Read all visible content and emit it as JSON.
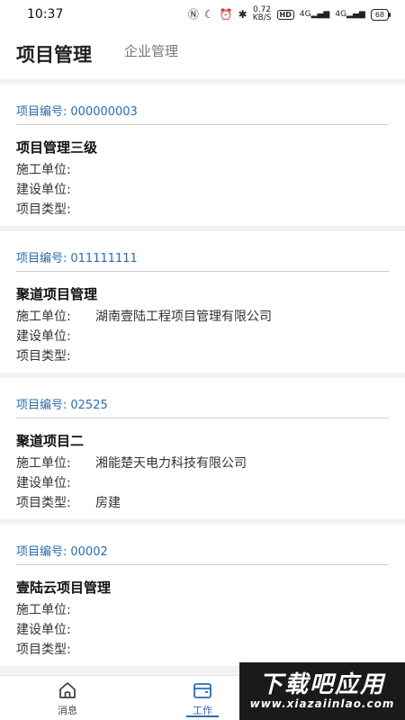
{
  "status": {
    "time": "10:37",
    "speed_value": "0.72",
    "speed_unit": "KB/S",
    "hd": "HD",
    "sig1": "4G",
    "sig2": "4G",
    "battery": "68"
  },
  "header": {
    "tab_active": "项目管理",
    "tab_inactive": "企业管理"
  },
  "projects": [
    {
      "id_label": "项目编号:",
      "id": "000000003",
      "name": "项目管理三级",
      "builder_label": "施工单位:",
      "builder": "",
      "owner_label": "建设单位:",
      "owner": "",
      "type_label": "项目类型:",
      "type": ""
    },
    {
      "id_label": "项目编号:",
      "id": "011111111",
      "name": "聚道项目管理",
      "builder_label": "施工单位:",
      "builder": "湖南壹陆工程项目管理有限公司",
      "owner_label": "建设单位:",
      "owner": "",
      "type_label": "项目类型:",
      "type": ""
    },
    {
      "id_label": "项目编号:",
      "id": "02525",
      "name": "聚道项目二",
      "builder_label": "施工单位:",
      "builder": "湘能楚天电力科技有限公司",
      "owner_label": "建设单位:",
      "owner": "",
      "type_label": "项目类型:",
      "type": "房建"
    },
    {
      "id_label": "项目编号:",
      "id": "00002",
      "name": "壹陆云项目管理",
      "builder_label": "施工单位:",
      "builder": "",
      "owner_label": "建设单位:",
      "owner": "",
      "type_label": "项目类型:",
      "type": ""
    }
  ],
  "tabbar": {
    "messages": "消息",
    "work": "工作"
  },
  "watermark": {
    "title": "下载吧应用",
    "url": "www.xiazaiinlao.com"
  },
  "colors": {
    "accent": "#2b6cb0"
  }
}
